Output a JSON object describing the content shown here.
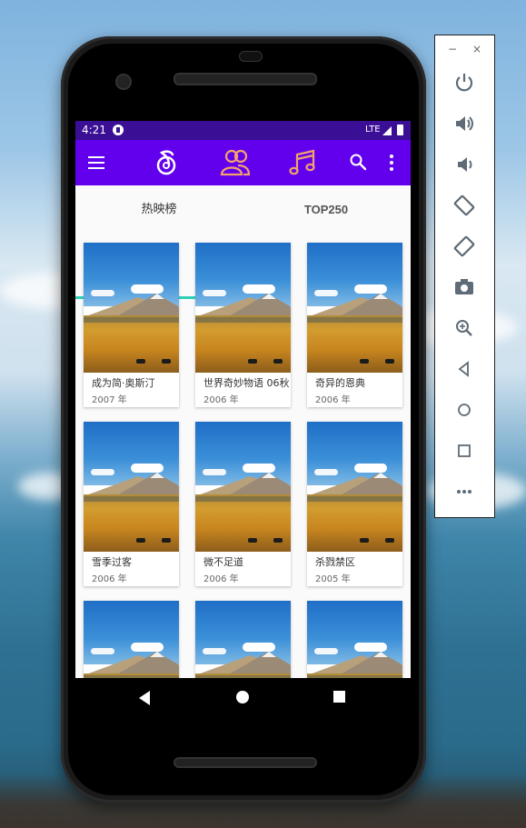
{
  "status_bar": {
    "time": "4:21",
    "network": "LTE"
  },
  "app_bar": {
    "menu_icon": "menu-icon",
    "tab_icons": [
      "music-note-circle-icon",
      "people-icon",
      "music-notes-icon"
    ],
    "search_icon": "search-icon",
    "more_icon": "more-vert-icon",
    "colors": {
      "status": "#3a0f96",
      "bar": "#6200ee",
      "accent_icon": "#f2a36a",
      "indicator": "#2fd0b8"
    }
  },
  "tabs": [
    {
      "label": "热映榜",
      "selected": true
    },
    {
      "label": "TOP250",
      "selected": false
    }
  ],
  "movies": [
    {
      "title": "成为简·奥斯汀",
      "year": "2007 年"
    },
    {
      "title": "世界奇妙物语 06秋",
      "year": "2006 年"
    },
    {
      "title": "奇异的恩典",
      "year": "2006 年"
    },
    {
      "title": "雪季过客",
      "year": "2006 年"
    },
    {
      "title": "微不足道",
      "year": "2006 年"
    },
    {
      "title": "杀戮禁区",
      "year": "2005 年"
    },
    {
      "title": "",
      "year": ""
    },
    {
      "title": "",
      "year": ""
    },
    {
      "title": "",
      "year": ""
    }
  ],
  "nav_bar": {
    "back": "back-icon",
    "home": "home-icon",
    "recents": "recents-icon"
  },
  "emulator_panel": {
    "window_controls": [
      "−",
      "×"
    ],
    "buttons": [
      "power-icon",
      "volume-up-icon",
      "volume-down-icon",
      "rotate-left-icon",
      "rotate-right-icon",
      "camera-icon",
      "zoom-icon",
      "back-icon",
      "home-icon",
      "overview-icon",
      "more-icon"
    ]
  }
}
